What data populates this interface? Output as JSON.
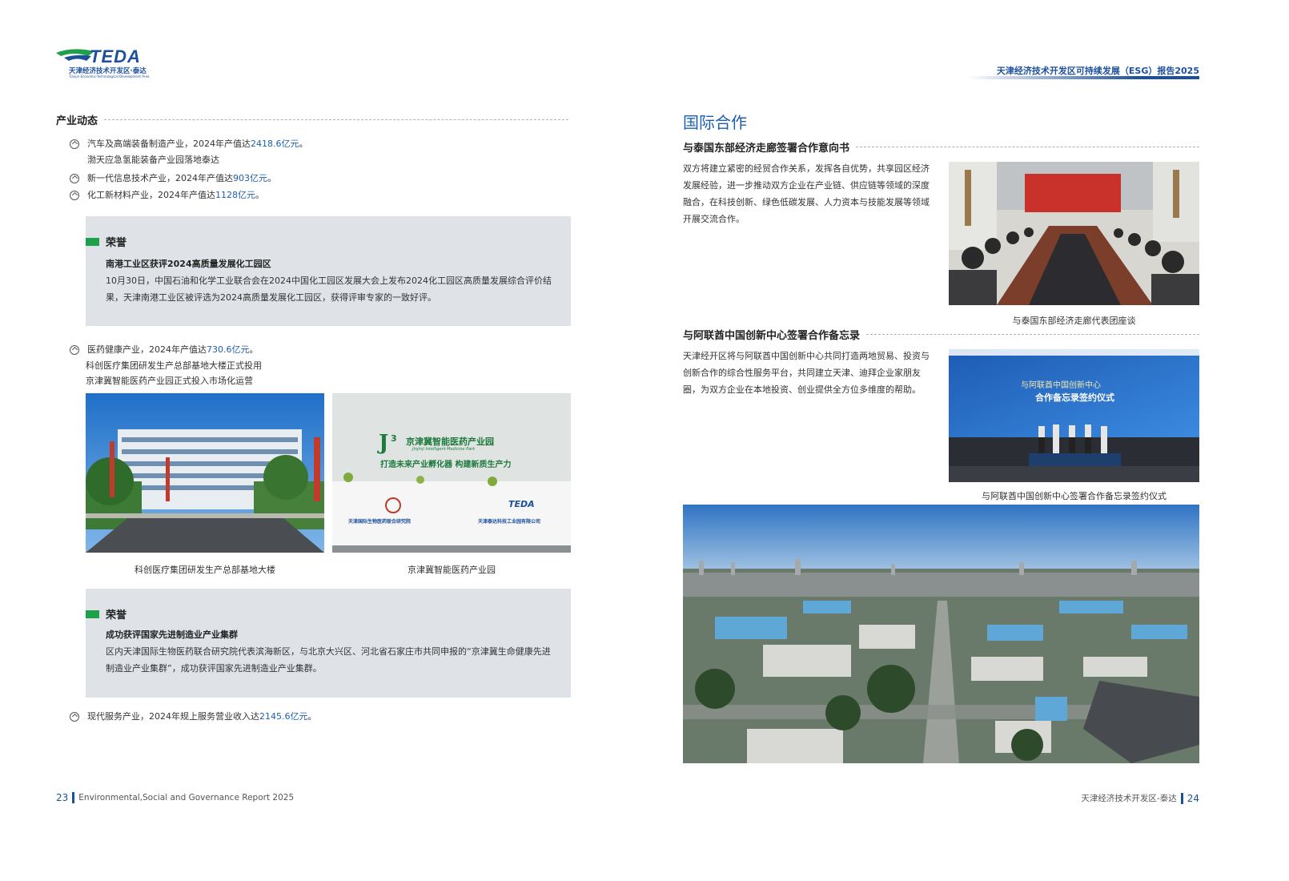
{
  "header": {
    "logo_text": "TEDA",
    "logo_subtitle": "天津经济技术开发区·泰达",
    "logo_subtitle_en": "Tianjin Economic-Technological Development Area",
    "report_title": "天津经济技术开发区可持续发展（ESG）报告2025"
  },
  "left": {
    "section_title": "产业动态",
    "items": [
      {
        "pre": "汽车及高端装备制造产业，2024年产值达",
        "value": "2418.6亿元",
        "post": "。",
        "sub": [
          "渤天应急氢能装备产业园落地泰达"
        ]
      },
      {
        "pre": "新一代信息技术产业，2024年产值达",
        "value": "903亿元",
        "post": "。",
        "sub": []
      },
      {
        "pre": "化工新材料产业，2024年产值达",
        "value": "1128亿元",
        "post": "。",
        "sub": []
      }
    ],
    "honor1": {
      "label": "荣誉",
      "subtitle": "南港工业区获评2024高质量发展化工园区",
      "text": "10月30日，中国石油和化学工业联合会在2024中国化工园区发展大会上发布2024化工园区高质量发展综合评价结果，天津南港工业区被评选为2024高质量发展化工园区，获得评审专家的一致好评。"
    },
    "item4": {
      "pre": "医药健康产业，2024年产值达",
      "value": "730.6亿元",
      "post": "。",
      "sub": [
        "科创医疗集团研发生产总部基地大楼正式投用",
        "京津冀智能医药产业园正式投入市场化运营"
      ]
    },
    "photos": [
      {
        "caption": "科创医疗集团研发生产总部基地大楼"
      },
      {
        "caption": "京津冀智能医药产业园",
        "sign_title": "京津冀智能医药产业园",
        "sign_en": "Jinjinji Intelligent Medicine Park",
        "slogan": "打造未来产业孵化器  构建新质生产力",
        "left_org": "天津国际生物医药联合研究院",
        "right_logo": "TEDA",
        "right_org": "天津泰达科技工业园有限公司"
      }
    ],
    "honor2": {
      "label": "荣誉",
      "subtitle": "成功获评国家先进制造业产业集群",
      "text": "区内天津国际生物医药联合研究院代表滨海新区，与北京大兴区、河北省石家庄市共同申报的“京津冀生命健康先进制造业产业集群”，成功获评国家先进制造业产业集群。"
    },
    "item5": {
      "pre": "现代服务产业，2024年规上服务营业收入达",
      "value": "2145.6亿元",
      "post": "。"
    }
  },
  "right": {
    "section_title": "国际合作",
    "coop1": {
      "title": "与泰国东部经济走廊签署合作意向书",
      "text": "双方将建立紧密的经贸合作关系，发挥各自优势，共享园区经济发展经验，进一步推动双方企业在产业链、供应链等领域的深度融合，在科技创新、绿色低碳发展、人力资本与技能发展等领域开展交流合作。",
      "caption": "与泰国东部经济走廊代表团座谈"
    },
    "coop2": {
      "title": "与阿联酋中国创新中心签署合作备忘录",
      "text": "天津经开区将与阿联酋中国创新中心共同打造两地贸易、投资与创新合作的综合性服务平台，共同建立天津、迪拜企业家朋友圈，为双方企业在本地投资、创业提供全方位多维度的帮助。",
      "caption": "与阿联酋中国创新中心签署合作备忘录签约仪式",
      "screen_line1": "与阿联酋中国创新中心",
      "screen_line2": "合作备忘录签约仪式"
    }
  },
  "footer": {
    "left_page": "23",
    "left_text": "Environmental,Social and Governance Report 2025",
    "right_text": "天津经济技术开发区-泰达",
    "right_page": "24"
  },
  "colors": {
    "brand_blue": "#1c4f9c",
    "highlight_blue": "#1c5fb0",
    "honor_green": "#1ea14a",
    "honor_bg": "#dfe3e8"
  }
}
